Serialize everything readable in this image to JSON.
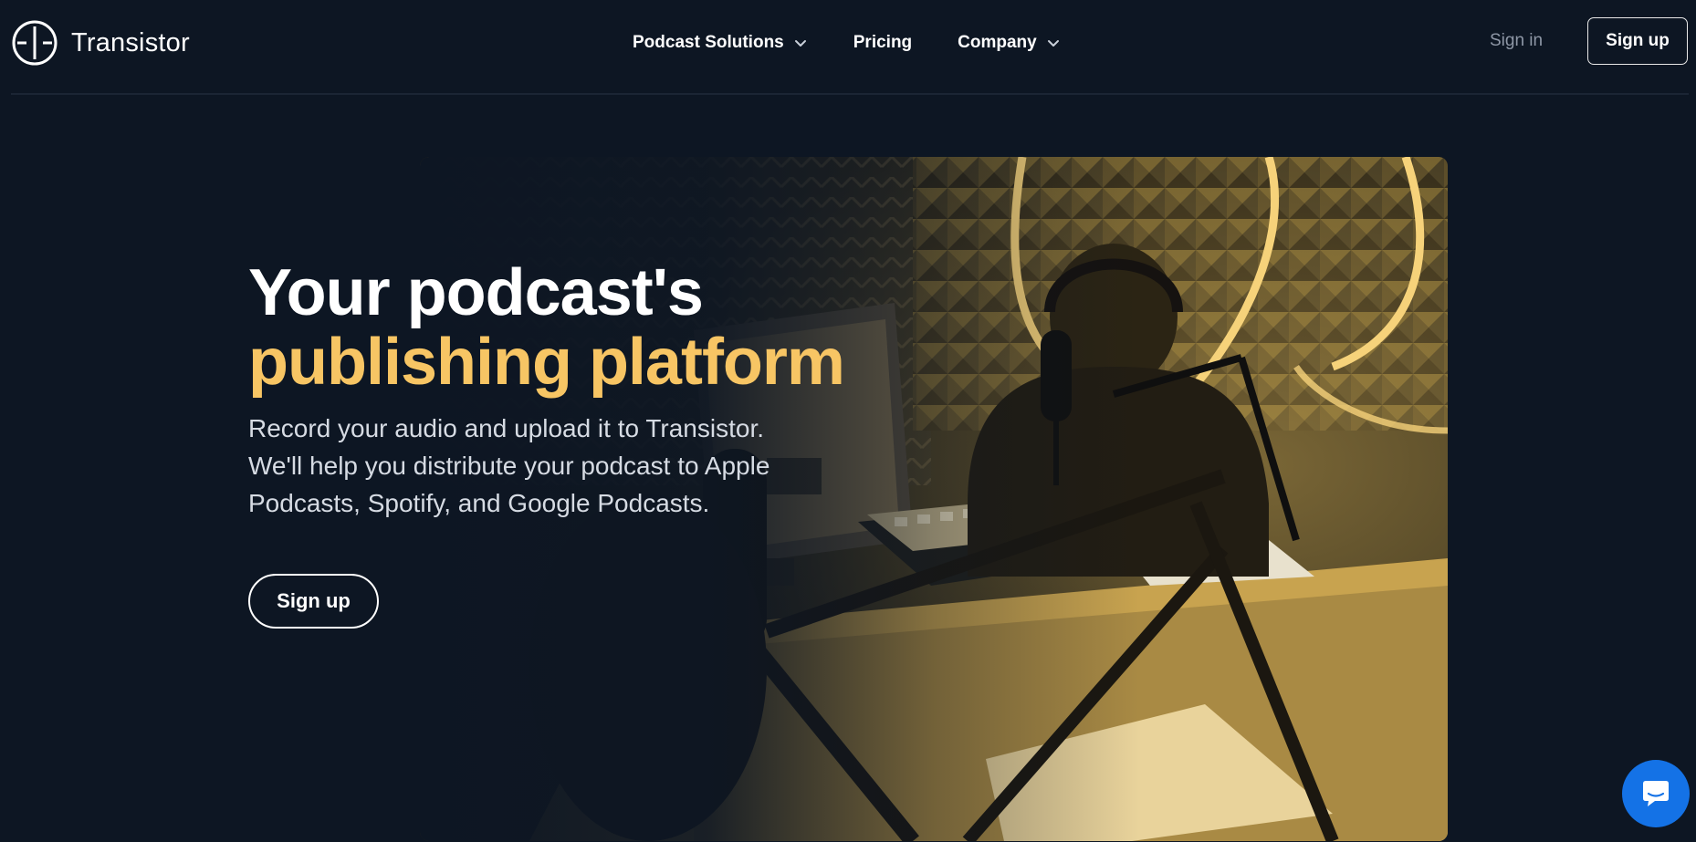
{
  "header": {
    "logo_text": "Transistor",
    "nav": [
      {
        "label": "Podcast Solutions",
        "has_dropdown": true
      },
      {
        "label": "Pricing",
        "has_dropdown": false
      },
      {
        "label": "Company",
        "has_dropdown": true
      }
    ],
    "sign_in_label": "Sign in",
    "sign_up_label": "Sign up"
  },
  "hero": {
    "headline_line1": "Your podcast's",
    "headline_line2": "publishing platform",
    "subtext": "Record your audio and upload it to Transistor. We'll help you distribute your podcast to Apple Podcasts, Spotify, and Google Podcasts.",
    "cta_label": "Sign up",
    "image_subject": "podcaster recording in a studio with microphone, mixer and computer monitor"
  },
  "chat_widget": {
    "icon": "chat-bubble-icon"
  },
  "colors": {
    "background": "#0d1623",
    "accent_yellow": "#f7c564",
    "muted_text": "#8e97a6",
    "chat_blue": "#1472e6"
  }
}
